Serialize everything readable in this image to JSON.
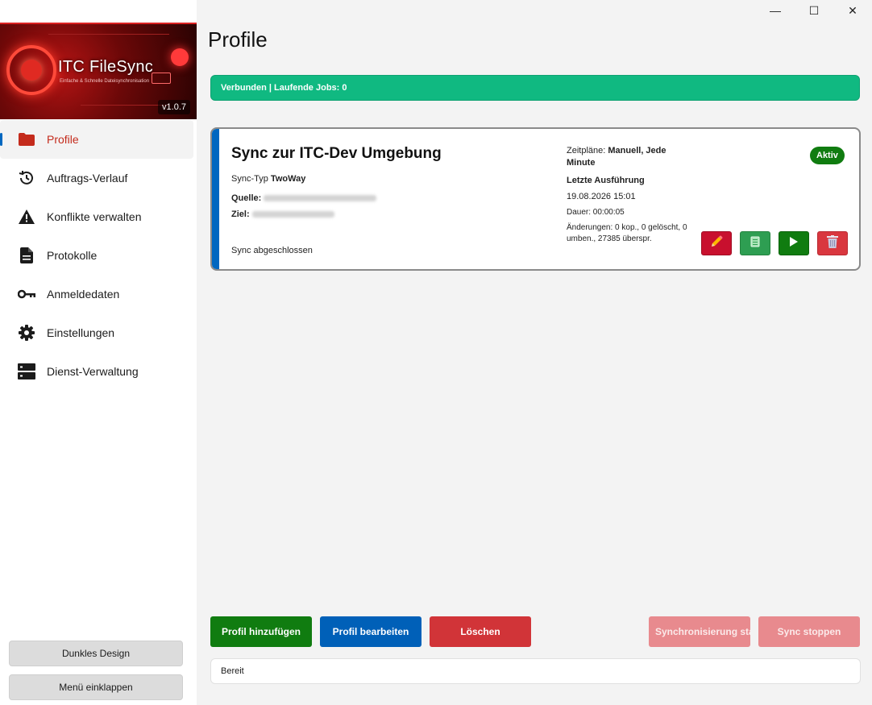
{
  "window": {
    "minimize": "—",
    "maximize": "☐",
    "close": "✕"
  },
  "logo": {
    "brand": "ITC FileSync",
    "tagline": "Einfache & Schnelle Dateisynchronisation",
    "version": "v1.0.7"
  },
  "sidebar": {
    "items": [
      {
        "label": "Profile",
        "icon": "folder-icon",
        "active": true
      },
      {
        "label": "Auftrags-Verlauf",
        "icon": "history-icon"
      },
      {
        "label": "Konflikte verwalten",
        "icon": "warning-icon"
      },
      {
        "label": "Protokolle",
        "icon": "document-icon"
      },
      {
        "label": "Anmeldedaten",
        "icon": "key-icon"
      },
      {
        "label": "Einstellungen",
        "icon": "gear-icon"
      },
      {
        "label": "Dienst-Verwaltung",
        "icon": "server-icon"
      }
    ],
    "dark_mode": "Dunkles Design",
    "collapse": "Menü einklappen"
  },
  "main": {
    "title": "Profile",
    "status_banner": "Verbunden | Laufende Jobs: 0",
    "profile": {
      "title": "Sync zur ITC-Dev Umgebung",
      "sync_type_label": "Sync-Typ",
      "sync_type": "TwoWay",
      "source_label": "Quelle:",
      "target_label": "Ziel:",
      "status": "Sync abgeschlossen",
      "schedules_label": "Zeitpläne:",
      "schedules": "Manuell, Jede Minute",
      "last_run_label": "Letzte Ausführung",
      "last_run": "19.08.2026 15:01",
      "duration": "Dauer: 00:00:05",
      "changes": "Änderungen: 0 kop., 0 gelöscht, 0 umben., 27385 überspr.",
      "badge": "Aktiv"
    },
    "buttons": {
      "add": "Profil hinzufügen",
      "edit": "Profil bearbeiten",
      "delete": "Löschen",
      "sync_start": "Synchronisierung starten",
      "sync_stop": "Sync stoppen"
    },
    "statusbar": "Bereit"
  },
  "colors": {
    "accent_blue": "#0067c0",
    "success": "#10b981",
    "green_btn": "#107c10",
    "blue_btn": "#0060b8",
    "red_btn": "#d13438",
    "disabled_red": "#e88a8e"
  }
}
